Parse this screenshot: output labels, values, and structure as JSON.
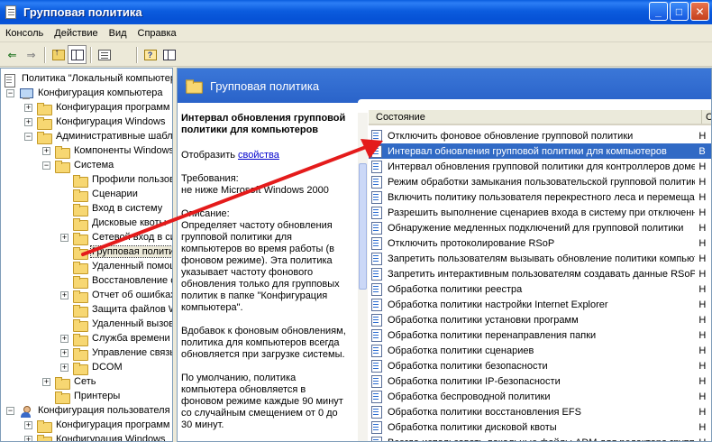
{
  "window": {
    "title": "Групповая политика",
    "min": "_",
    "max": "□",
    "close": "✕"
  },
  "menu": [
    {
      "label": "Консоль",
      "key": "К"
    },
    {
      "label": "Действие",
      "key": "Д"
    },
    {
      "label": "Вид",
      "key": "В"
    },
    {
      "label": "Справка",
      "key": "С"
    }
  ],
  "toolbar": {
    "back": "⇐",
    "forward": "⇒"
  },
  "tree": {
    "items": [
      {
        "label": "Политика \"Локальный компьютер\"",
        "icon": "doc-icon",
        "level": 0,
        "expander": ""
      },
      {
        "label": "Конфигурация компьютера",
        "icon": "computer-icon",
        "level": 1,
        "expander": "−"
      },
      {
        "label": "Конфигурация программ",
        "icon": "folder-icon",
        "level": 2,
        "expander": "+"
      },
      {
        "label": "Конфигурация Windows",
        "icon": "folder-icon",
        "level": 2,
        "expander": "+"
      },
      {
        "label": "Административные шаблоны",
        "icon": "folder-icon",
        "level": 2,
        "expander": "−"
      },
      {
        "label": "Компоненты Windows",
        "icon": "folder-icon",
        "level": 3,
        "expander": "+"
      },
      {
        "label": "Система",
        "icon": "folder-icon",
        "level": 3,
        "expander": "−"
      },
      {
        "label": "Профили пользователей",
        "icon": "folder-icon",
        "level": 4,
        "expander": ""
      },
      {
        "label": "Сценарии",
        "icon": "folder-icon",
        "level": 4,
        "expander": ""
      },
      {
        "label": "Вход в систему",
        "icon": "folder-icon",
        "level": 4,
        "expander": ""
      },
      {
        "label": "Дисковые квоты",
        "icon": "folder-icon",
        "level": 4,
        "expander": ""
      },
      {
        "label": "Сетевой вход в систему",
        "icon": "folder-icon",
        "level": 4,
        "expander": "+"
      },
      {
        "label": "Групповая политика",
        "icon": "folder-icon",
        "level": 4,
        "expander": "",
        "selected": true
      },
      {
        "label": "Удаленный помощник",
        "icon": "folder-icon",
        "level": 4,
        "expander": ""
      },
      {
        "label": "Восстановление системы",
        "icon": "folder-icon",
        "level": 4,
        "expander": ""
      },
      {
        "label": "Отчет об ошибках",
        "icon": "folder-icon",
        "level": 4,
        "expander": "+"
      },
      {
        "label": "Защита файлов Windows",
        "icon": "folder-icon",
        "level": 4,
        "expander": ""
      },
      {
        "label": "Удаленный вызов процедур",
        "icon": "folder-icon",
        "level": 4,
        "expander": ""
      },
      {
        "label": "Служба времени Windows",
        "icon": "folder-icon",
        "level": 4,
        "expander": "+"
      },
      {
        "label": "Управление связью через Интернет",
        "icon": "folder-icon",
        "level": 4,
        "expander": "+"
      },
      {
        "label": "DCOM",
        "icon": "folder-icon",
        "level": 4,
        "expander": "+"
      },
      {
        "label": "Сеть",
        "icon": "folder-icon",
        "level": 3,
        "expander": "+"
      },
      {
        "label": "Принтеры",
        "icon": "folder-icon",
        "level": 3,
        "expander": ""
      },
      {
        "label": "Конфигурация пользователя",
        "icon": "user-icon",
        "level": 1,
        "expander": "−"
      },
      {
        "label": "Конфигурация программ",
        "icon": "folder-icon",
        "level": 2,
        "expander": "+"
      },
      {
        "label": "Конфигурация Windows",
        "icon": "folder-icon",
        "level": 2,
        "expander": "+"
      }
    ]
  },
  "header": {
    "title": "Групповая политика"
  },
  "description": {
    "title": "Интервал обновления групповой политики для компьютеров",
    "show_prefix": "Отобразить ",
    "show_link": "свойства",
    "requirements": "Требования:\nне ниже Microsoft Windows 2000",
    "description": "Описание:\nОпределяет частоту обновления групповой политики для компьютеров во время работы (в фоновом режиме). Эта политика указывает частоту фонового обновления только для групповых политик в папке \"Конфигурация компьютера\".",
    "para2": "Вдобавок к фоновым обновлениям, политика для компьютеров всегда обновляется при загрузке системы.",
    "para3": "По умолчанию, политика компьютера обновляется в фоновом режиме каждые 90 минут со случайным смещением от 0 до 30 минут."
  },
  "list": {
    "col_name": "Состояние",
    "col_state": "С",
    "rows": [
      {
        "name": "Отключить фоновое обновление групповой политики",
        "state": "Н"
      },
      {
        "name": "Интервал обновления групповой политики для компьютеров",
        "state": "В",
        "selected": true
      },
      {
        "name": "Интервал обновления групповой политики для контроллеров домена",
        "state": "Н"
      },
      {
        "name": "Режим обработки замыкания пользовательской групповой политики",
        "state": "Н"
      },
      {
        "name": "Включить политику пользователя перекрестного леса и перемещаемые профили",
        "state": "Н"
      },
      {
        "name": "Разрешить выполнение сценариев входа в систему при отключенной петле",
        "state": "Н"
      },
      {
        "name": "Обнаружение медленных подключений для групповой политики",
        "state": "Н"
      },
      {
        "name": "Отключить протоколирование RSoP",
        "state": "Н"
      },
      {
        "name": "Запретить пользователям вызывать обновление политики компьютера",
        "state": "Н"
      },
      {
        "name": "Запретить интерактивным пользователям создавать данные RSoP",
        "state": "Н"
      },
      {
        "name": "Обработка политики реестра",
        "state": "Н"
      },
      {
        "name": "Обработка политики настройки Internet Explorer",
        "state": "Н"
      },
      {
        "name": "Обработка политики установки программ",
        "state": "Н"
      },
      {
        "name": "Обработка политики перенаправления папки",
        "state": "Н"
      },
      {
        "name": "Обработка политики сценариев",
        "state": "Н"
      },
      {
        "name": "Обработка политики безопасности",
        "state": "Н"
      },
      {
        "name": "Обработка политики IP-безопасности",
        "state": "Н"
      },
      {
        "name": "Обработка беспроводной политики",
        "state": "Н"
      },
      {
        "name": "Обработка политики восстановления EFS",
        "state": "Н"
      },
      {
        "name": "Обработка политики дисковой квоты",
        "state": "Н"
      },
      {
        "name": "Всегда использовать локальные файлы ADM для редактора групповой политики",
        "state": "Н"
      }
    ]
  },
  "colors": {
    "title_bar": "#0b5cde",
    "selection": "#316ac5",
    "arrow": "#e41b1b"
  }
}
